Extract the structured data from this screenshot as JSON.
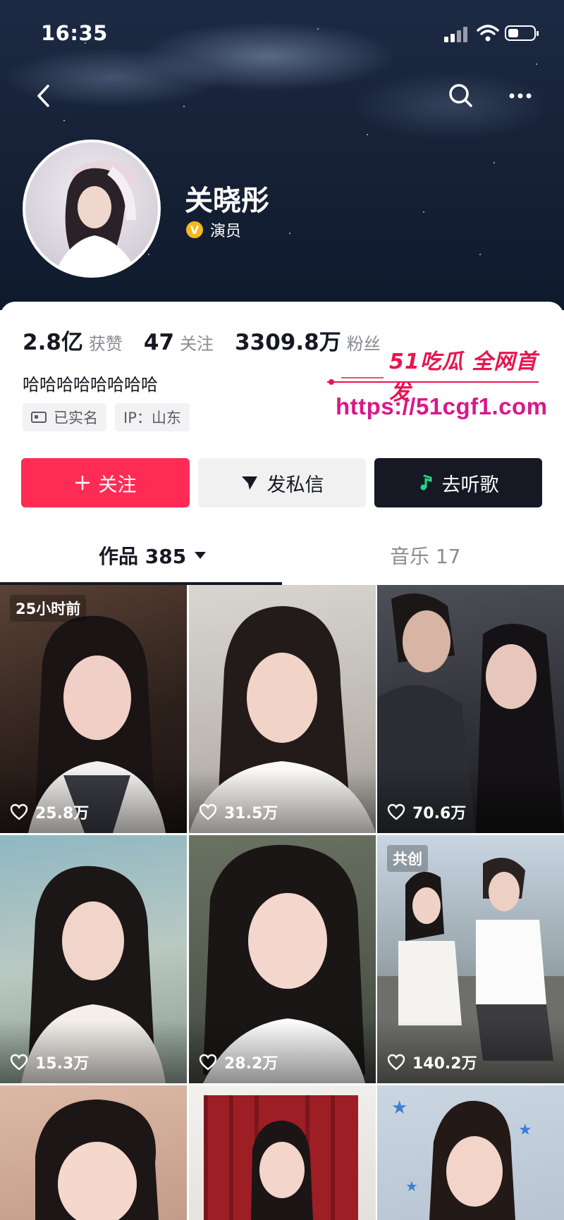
{
  "status_bar": {
    "time": "16:35"
  },
  "profile": {
    "name": "关晓彤",
    "verified_label": "演员",
    "verify_badge": "V",
    "stats": [
      {
        "value": "2.8亿",
        "label": "获赞"
      },
      {
        "value": "47",
        "label": "关注"
      },
      {
        "value": "3309.8万",
        "label": "粉丝"
      }
    ],
    "bio": "哈哈哈哈哈哈哈哈",
    "tags": [
      {
        "icon": "id-card-icon",
        "label": "已实名"
      },
      {
        "label": "IP：山东"
      }
    ]
  },
  "watermark": {
    "title": "51吃瓜 全网首发",
    "url": "https://51cgf1.com"
  },
  "actions": {
    "follow_label": "关注",
    "message_label": "发私信",
    "music_label": "去听歌"
  },
  "tabs": {
    "works_label": "作品 385",
    "music_label": "音乐 17"
  },
  "videos": [
    {
      "likes": "25.8万",
      "badge": "25小时前"
    },
    {
      "likes": "31.5万",
      "badge": ""
    },
    {
      "likes": "70.6万",
      "badge": ""
    },
    {
      "likes": "15.3万",
      "badge": ""
    },
    {
      "likes": "28.2万",
      "badge": ""
    },
    {
      "likes": "140.2万",
      "badge": "共创"
    },
    {
      "likes": "",
      "badge": ""
    },
    {
      "likes": "",
      "badge": ""
    },
    {
      "likes": "",
      "badge": ""
    }
  ],
  "colors": {
    "primary": "#fe2c55",
    "dark_button": "#161823",
    "light_button": "#f1f1f2",
    "watermark_red": "#e8144f",
    "watermark_pink": "#d9178a",
    "verify_gold": "#f5b820"
  },
  "icons": {
    "back": "back-arrow-icon",
    "search": "search-icon",
    "more": "more-dots-icon",
    "follow": "plus-icon",
    "message": "send-arrow-icon",
    "music": "music-note-icon",
    "likes": "heart-icon"
  }
}
